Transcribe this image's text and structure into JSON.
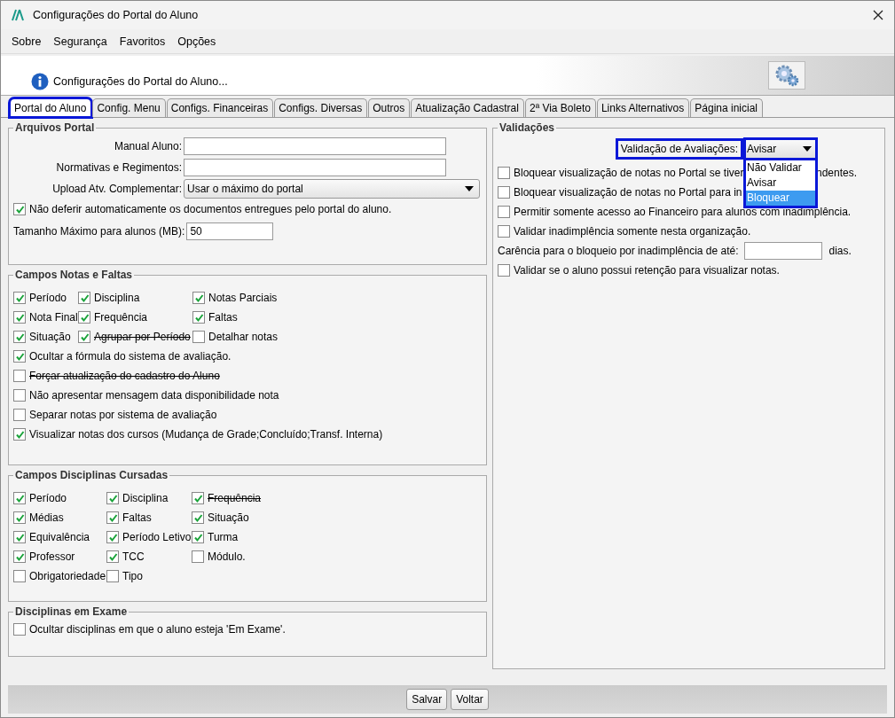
{
  "window": {
    "title": "Configurações do Portal do Aluno"
  },
  "menu": [
    "Sobre",
    "Segurança",
    "Favoritos",
    "Opções"
  ],
  "header": {
    "title": "Configurações do Portal do Aluno..."
  },
  "tabs": [
    {
      "label": "Portal do Aluno",
      "selected": true,
      "annotated": true
    },
    {
      "label": "Config. Menu",
      "selected": false,
      "annotated": false
    },
    {
      "label": "Configs. Financeiras",
      "selected": false,
      "annotated": false
    },
    {
      "label": "Configs. Diversas",
      "selected": false,
      "annotated": false
    },
    {
      "label": "Outros",
      "selected": false,
      "annotated": false
    },
    {
      "label": "Atualização Cadastral",
      "selected": false,
      "annotated": false
    },
    {
      "label": "2ª Via Boleto",
      "selected": false,
      "annotated": false
    },
    {
      "label": "Links Alternativos",
      "selected": false,
      "annotated": false
    },
    {
      "label": "Página inicial",
      "selected": false,
      "annotated": false
    }
  ],
  "arquivos": {
    "title": "Arquivos Portal",
    "manual_label": "Manual Aluno:",
    "normativas_label": "Normativas e Regimentos:",
    "upload_label": "Upload Atv. Complementar:",
    "upload_value": "Usar o máximo do portal",
    "deferir": {
      "label": "Não deferir automaticamente os documentos entregues pelo portal do aluno.",
      "checked": true
    },
    "tamanho_label": "Tamanho Máximo para alunos (MB):",
    "tamanho_value": "50"
  },
  "notas": {
    "title": "Campos Notas e Faltas",
    "grid": [
      {
        "label": "Período",
        "checked": true,
        "struck": false
      },
      {
        "label": "Disciplina",
        "checked": true,
        "struck": false
      },
      {
        "label": "Notas Parciais",
        "checked": true,
        "struck": false
      },
      {
        "label": "Nota Final",
        "checked": true,
        "struck": false
      },
      {
        "label": "Frequência",
        "checked": true,
        "struck": false
      },
      {
        "label": "Faltas",
        "checked": true,
        "struck": false
      },
      {
        "label": "Situação",
        "checked": true,
        "struck": false
      },
      {
        "label": "Agrupar por Período",
        "checked": true,
        "struck": true
      },
      {
        "label": "Detalhar notas",
        "checked": false,
        "struck": false
      }
    ],
    "rows": [
      {
        "label": "Ocultar a fórmula do sistema de avaliação.",
        "checked": true,
        "struck": false
      },
      {
        "label": "Forçar atualização do cadastro do Aluno",
        "checked": false,
        "struck": true
      },
      {
        "label": "Não apresentar mensagem data disponibilidade nota",
        "checked": false,
        "struck": false
      },
      {
        "label": "Separar notas por sistema de avaliação",
        "checked": false,
        "struck": false
      },
      {
        "label": "Visualizar notas dos cursos (Mudança de Grade;Concluído;Transf. Interna)",
        "checked": true,
        "struck": false
      }
    ]
  },
  "cursadas": {
    "title": "Campos Disciplinas Cursadas",
    "grid": [
      {
        "label": "Período",
        "checked": true,
        "struck": false
      },
      {
        "label": "Disciplina",
        "checked": true,
        "struck": false
      },
      {
        "label": "Frequência",
        "checked": true,
        "struck": true
      },
      {
        "label": "Médias",
        "checked": true,
        "struck": false
      },
      {
        "label": "Faltas",
        "checked": true,
        "struck": false
      },
      {
        "label": "Situação",
        "checked": true,
        "struck": false
      },
      {
        "label": "Equivalência",
        "checked": true,
        "struck": false
      },
      {
        "label": "Período Letivo",
        "checked": true,
        "struck": false
      },
      {
        "label": "Turma",
        "checked": true,
        "struck": false
      },
      {
        "label": "Professor",
        "checked": true,
        "struck": false
      },
      {
        "label": "TCC",
        "checked": true,
        "struck": false
      },
      {
        "label": "Módulo.",
        "checked": false,
        "struck": false
      },
      {
        "label": "Obrigatoriedade",
        "checked": false,
        "struck": false
      },
      {
        "label": "Tipo",
        "checked": false,
        "struck": false
      }
    ]
  },
  "exame": {
    "title": "Disciplinas em Exame",
    "rows": [
      {
        "label": "Ocultar disciplinas em que o aluno esteja 'Em Exame'.",
        "checked": false
      }
    ]
  },
  "validacoes": {
    "title": "Validações",
    "select_label": "Validação de Avaliações:",
    "label_annotated": true,
    "select_value": "Avisar",
    "select_annotated": true,
    "options": [
      {
        "label": "Não Validar",
        "selected": false
      },
      {
        "label": "Avisar",
        "selected": false
      },
      {
        "label": "Bloquear",
        "selected": true
      }
    ],
    "rows": [
      {
        "label": "Bloquear visualização de notas no Portal se tiver",
        "tail": "ndentes.",
        "checked": false
      },
      {
        "label": "Bloquear visualização de notas no Portal para in",
        "checked": false
      },
      {
        "label": "Permitir somente acesso ao Financeiro para alunos com inadimplência.",
        "checked": false
      },
      {
        "label": "Validar inadimplência somente nesta organização.",
        "checked": false
      }
    ],
    "carencia_label": "Carência para o bloqueio por inadimplência de até:",
    "carencia_unit": "dias.",
    "retencao": {
      "label": "Validar se o aluno possui retenção para visualizar notas.",
      "checked": false
    }
  },
  "buttons": [
    "Salvar",
    "Voltar"
  ]
}
